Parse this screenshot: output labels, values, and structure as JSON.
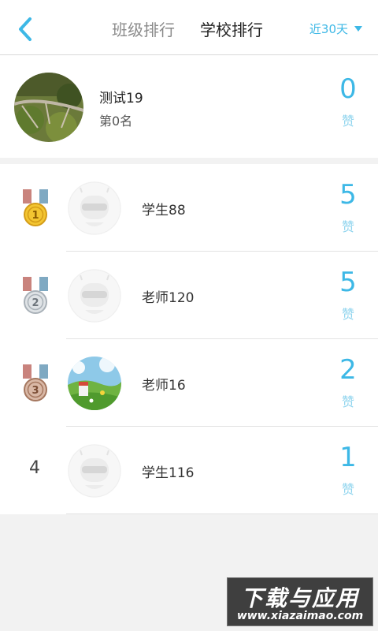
{
  "header": {
    "tabs": [
      {
        "label": "班级排行",
        "active": false
      },
      {
        "label": "学校排行",
        "active": true
      }
    ],
    "period": "近30天",
    "accent_color": "#3db8e6"
  },
  "me": {
    "name": "测试19",
    "rank_text": "第0名",
    "likes": "0",
    "likes_unit": "赞"
  },
  "ranking": [
    {
      "rank": "1",
      "medal": "gold",
      "name": "学生88",
      "likes": "5",
      "likes_unit": "赞",
      "avatar": "default-robot"
    },
    {
      "rank": "2",
      "medal": "silver",
      "name": "老师120",
      "likes": "5",
      "likes_unit": "赞",
      "avatar": "default-robot"
    },
    {
      "rank": "3",
      "medal": "bronze",
      "name": "老师16",
      "likes": "2",
      "likes_unit": "赞",
      "avatar": "landscape-photo"
    },
    {
      "rank": "4",
      "medal": null,
      "name": "学生116",
      "likes": "1",
      "likes_unit": "赞",
      "avatar": "default-robot"
    }
  ],
  "watermark": {
    "title": "下载与应用",
    "url": "www.xiazaimao.com"
  }
}
